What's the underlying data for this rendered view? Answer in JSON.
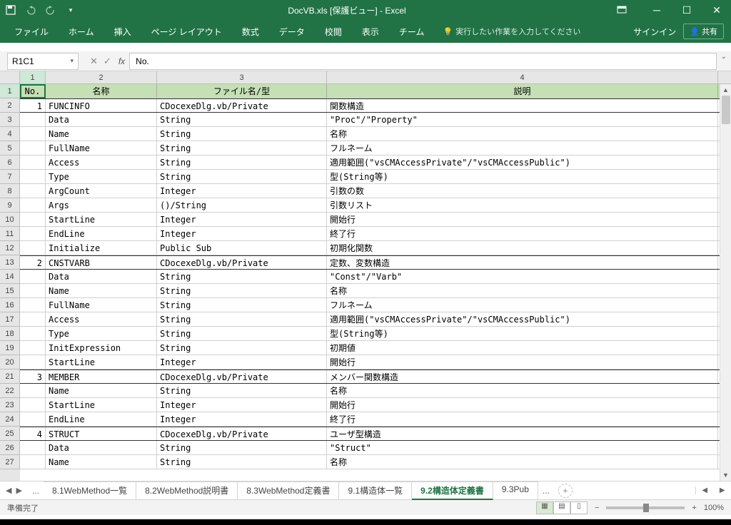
{
  "window": {
    "title": "DocVB.xls [保護ビュー] - Excel",
    "signin": "サインイン",
    "share": "共有"
  },
  "ribbon": {
    "tabs": [
      "ファイル",
      "ホーム",
      "挿入",
      "ページ レイアウト",
      "数式",
      "データ",
      "校閲",
      "表示",
      "チーム"
    ],
    "tell_me": "実行したい作業を入力してください"
  },
  "formula_bar": {
    "name_box": "R1C1",
    "formula": "No."
  },
  "columns": [
    "1",
    "2",
    "3",
    "4"
  ],
  "header_row": {
    "no": "No.",
    "name": "名称",
    "file": "ファイル名/型",
    "desc": "説明"
  },
  "rows": [
    {
      "no": "1",
      "name": "FUNCINFO",
      "file": "CDocexeDlg.vb/Private",
      "desc": "関数構造",
      "section": true
    },
    {
      "no": "",
      "name": "Data",
      "file": "String",
      "desc": "\"Proc\"/\"Property\""
    },
    {
      "no": "",
      "name": "Name",
      "file": "String",
      "desc": "名称"
    },
    {
      "no": "",
      "name": "FullName",
      "file": "String",
      "desc": "フルネーム"
    },
    {
      "no": "",
      "name": "Access",
      "file": "String",
      "desc": "適用範囲(\"vsCMAccessPrivate\"/\"vsCMAccessPublic\")"
    },
    {
      "no": "",
      "name": "Type",
      "file": "String",
      "desc": "型(String等)"
    },
    {
      "no": "",
      "name": "ArgCount",
      "file": "Integer",
      "desc": "引数の数"
    },
    {
      "no": "",
      "name": "Args",
      "file": "()/String",
      "desc": "引数リスト"
    },
    {
      "no": "",
      "name": "StartLine",
      "file": "Integer",
      "desc": "開始行"
    },
    {
      "no": "",
      "name": "EndLine",
      "file": "Integer",
      "desc": "終了行"
    },
    {
      "no": "",
      "name": "Initialize",
      "file": "Public Sub",
      "desc": "初期化関数"
    },
    {
      "no": "2",
      "name": "CNSTVARB",
      "file": "CDocexeDlg.vb/Private",
      "desc": "定数、変数構造",
      "section": true
    },
    {
      "no": "",
      "name": "Data",
      "file": "String",
      "desc": "\"Const\"/\"Varb\""
    },
    {
      "no": "",
      "name": "Name",
      "file": "String",
      "desc": "名称"
    },
    {
      "no": "",
      "name": "FullName",
      "file": "String",
      "desc": "フルネーム"
    },
    {
      "no": "",
      "name": "Access",
      "file": "String",
      "desc": "適用範囲(\"vsCMAccessPrivate\"/\"vsCMAccessPublic\")"
    },
    {
      "no": "",
      "name": "Type",
      "file": "String",
      "desc": "型(String等)"
    },
    {
      "no": "",
      "name": "InitExpression",
      "file": "String",
      "desc": "初期値"
    },
    {
      "no": "",
      "name": "StartLine",
      "file": "Integer",
      "desc": "開始行"
    },
    {
      "no": "3",
      "name": "MEMBER",
      "file": "CDocexeDlg.vb/Private",
      "desc": "メンバー関数構造",
      "section": true
    },
    {
      "no": "",
      "name": "Name",
      "file": "String",
      "desc": "名称"
    },
    {
      "no": "",
      "name": "StartLine",
      "file": "Integer",
      "desc": "開始行"
    },
    {
      "no": "",
      "name": "EndLine",
      "file": "Integer",
      "desc": "終了行"
    },
    {
      "no": "4",
      "name": "STRUCT",
      "file": "CDocexeDlg.vb/Private",
      "desc": "ユーザ型構造",
      "section": true
    },
    {
      "no": "",
      "name": "Data",
      "file": "String",
      "desc": "\"Struct\""
    },
    {
      "no": "",
      "name": "Name",
      "file": "String",
      "desc": "名称"
    }
  ],
  "sheet_tabs": {
    "dots_left": "...",
    "tabs": [
      {
        "label": "8.1WebMethod一覧",
        "active": false
      },
      {
        "label": "8.2WebMethod説明書",
        "active": false
      },
      {
        "label": "8.3WebMethod定義書",
        "active": false
      },
      {
        "label": "9.1構造体一覧",
        "active": false
      },
      {
        "label": "9.2構造体定義書",
        "active": true
      },
      {
        "label": "9.3Pub",
        "active": false
      }
    ],
    "dots_right": "..."
  },
  "status": {
    "ready": "準備完了",
    "zoom": "100%",
    "zoom_minus": "−",
    "zoom_plus": "+"
  }
}
